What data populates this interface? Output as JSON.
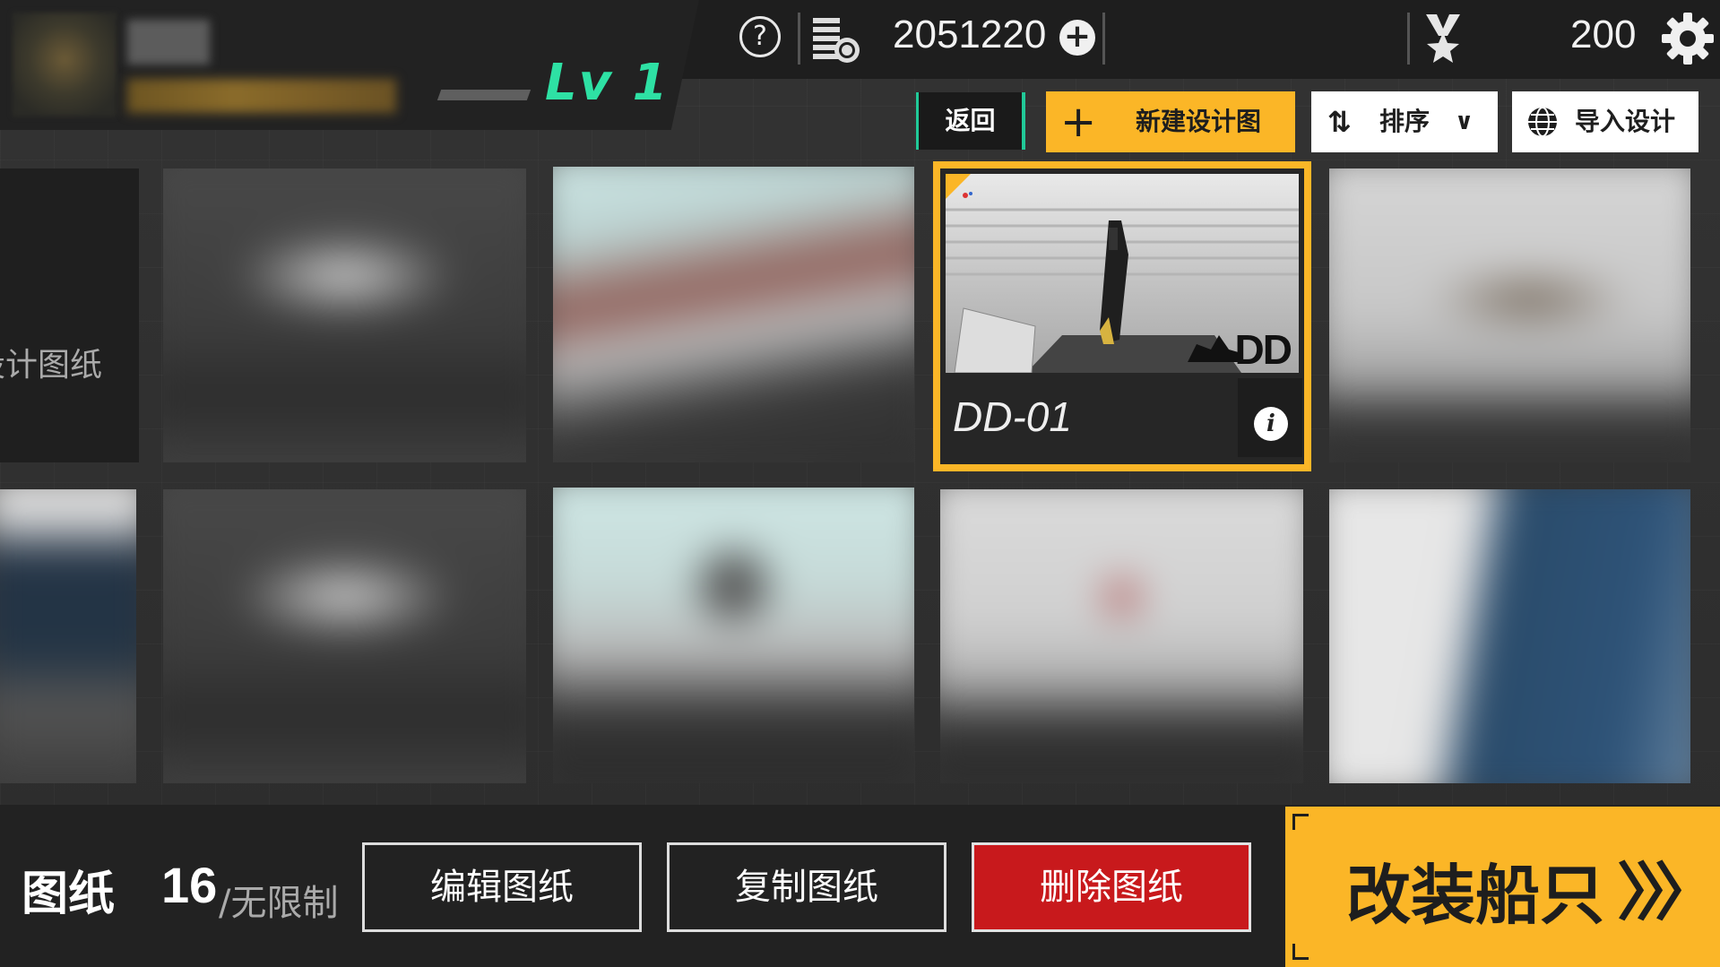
{
  "player": {
    "level": "Lv 1"
  },
  "header": {
    "help_symbol": "?",
    "currency_value": "2051220",
    "currency_add_symbol": "+",
    "medal_value": "200"
  },
  "actions": {
    "back_label": "返回",
    "new_design_label": "新建设计图",
    "new_design_symbol": "+",
    "sort_label": "排序",
    "import_label": "导入设计"
  },
  "grid": {
    "partial_left_label": "设计图纸",
    "selected": {
      "name": "DD-01",
      "class_tag": "DD"
    }
  },
  "footer": {
    "blueprints_label": "图纸",
    "blueprints_count": "16",
    "blueprints_limit": "/无限制",
    "edit_label": "编辑图纸",
    "copy_label": "复制图纸",
    "delete_label": "删除图纸",
    "modify_ship_label": "改装船只"
  },
  "colors": {
    "accent_yellow": "#fbb627",
    "accent_green": "#2ee1a4",
    "delete_red": "#c8191c"
  },
  "icons": [
    "help-icon",
    "coin-icon",
    "add-currency-icon",
    "medal-icon",
    "gear-icon",
    "sort-icon",
    "chevron-down-icon",
    "globe-icon",
    "info-icon",
    "arrows-right-icon"
  ]
}
